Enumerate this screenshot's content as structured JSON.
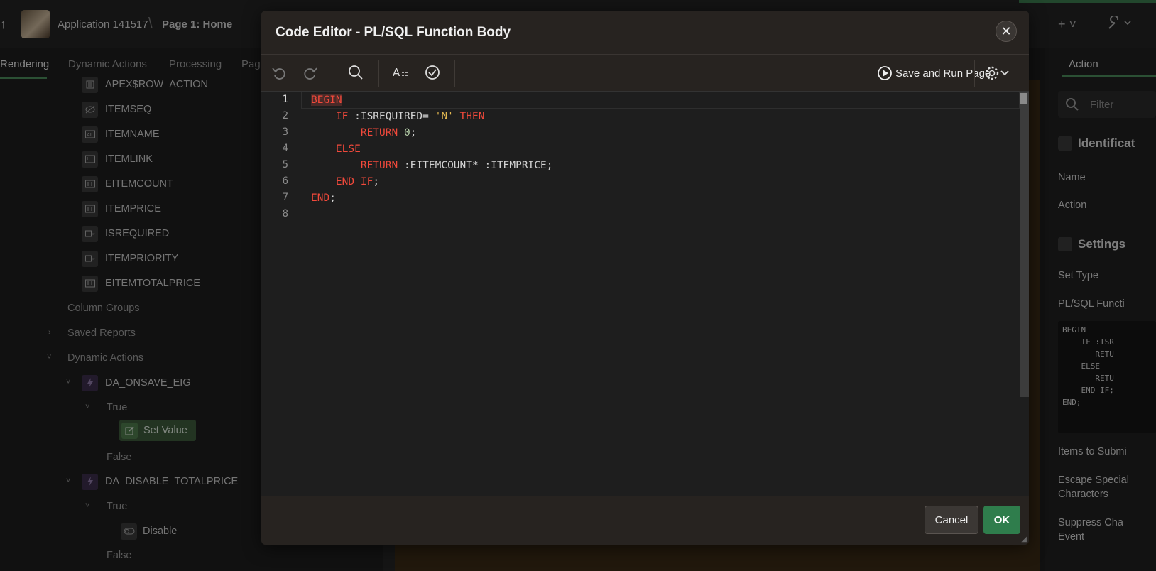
{
  "app": {
    "breadcrumb_app": "Application 141517",
    "breadcrumb_page": "Page 1: Home"
  },
  "left_tabs": [
    "Rendering",
    "Dynamic Actions",
    "Processing",
    "Pag"
  ],
  "tree": {
    "columns": [
      "APEX$ROW_ACTION",
      "ITEMSEQ",
      "ITEMNAME",
      "ITEMLINK",
      "EITEMCOUNT",
      "ITEMPRICE",
      "ISREQUIRED",
      "ITEMPRIORITY",
      "EITEMTOTALPRICE"
    ],
    "column_groups": "Column Groups",
    "saved_reports": "Saved Reports",
    "dynamic_actions": "Dynamic Actions",
    "da1": "DA_ONSAVE_EIG",
    "da1_true": "True",
    "da1_action": "Set Value",
    "da1_false": "False",
    "da2": "DA_DISABLE_TOTALPRICE",
    "da2_true": "True",
    "da2_action": "Disable",
    "da2_false": "False"
  },
  "right_panel": {
    "tab": "Action",
    "filter_placeholder": "Filter",
    "section_identification": "Identificat",
    "label_name": "Name",
    "label_action": "Action",
    "section_settings": "Settings",
    "label_set_type": "Set Type",
    "label_plsql": "PL/SQL Functi",
    "code_preview": "BEGIN\n    IF :ISR\n       RETU\n    ELSE\n       RETU\n    END IF;\nEND;",
    "label_items_submit": "Items to Submi",
    "label_escape_1": "Escape Special",
    "label_escape_2": "Characters",
    "label_suppress_1": "Suppress Cha",
    "label_suppress_2": "Event"
  },
  "modal": {
    "title": "Code Editor - PL/SQL Function Body",
    "save_run": "Save and Run Page",
    "cancel": "Cancel",
    "ok": "OK",
    "line_numbers": [
      "1",
      "2",
      "3",
      "4",
      "5",
      "6",
      "7",
      "8"
    ],
    "code": {
      "l1_kw": "BEGIN",
      "l2_pre": "    ",
      "l2_kw1": "IF",
      "l2_mid": " :ISREQUIRED= ",
      "l2_str": "'N'",
      "l2_sp": " ",
      "l2_kw2": "THEN",
      "l3_pre": "        ",
      "l3_kw": "RETURN",
      "l3_sp": " ",
      "l3_num": "0",
      "l3_end": ";",
      "l4_pre": "    ",
      "l4_kw": "ELSE",
      "l5_pre": "        ",
      "l5_kw": "RETURN",
      "l5_rest": " :EITEMCOUNT* :ITEMPRICE;",
      "l6_pre": "    ",
      "l6_kw1": "END",
      "l6_sp": " ",
      "l6_kw2": "IF",
      "l6_end": ";",
      "l7_kw": "END",
      "l7_end": ";"
    }
  },
  "colors": {
    "keyword": "#f1493b",
    "string": "#e0b650",
    "number": "#b5cea8",
    "ok_button": "#2f7d4c",
    "accent_green": "#4a8a5a"
  }
}
